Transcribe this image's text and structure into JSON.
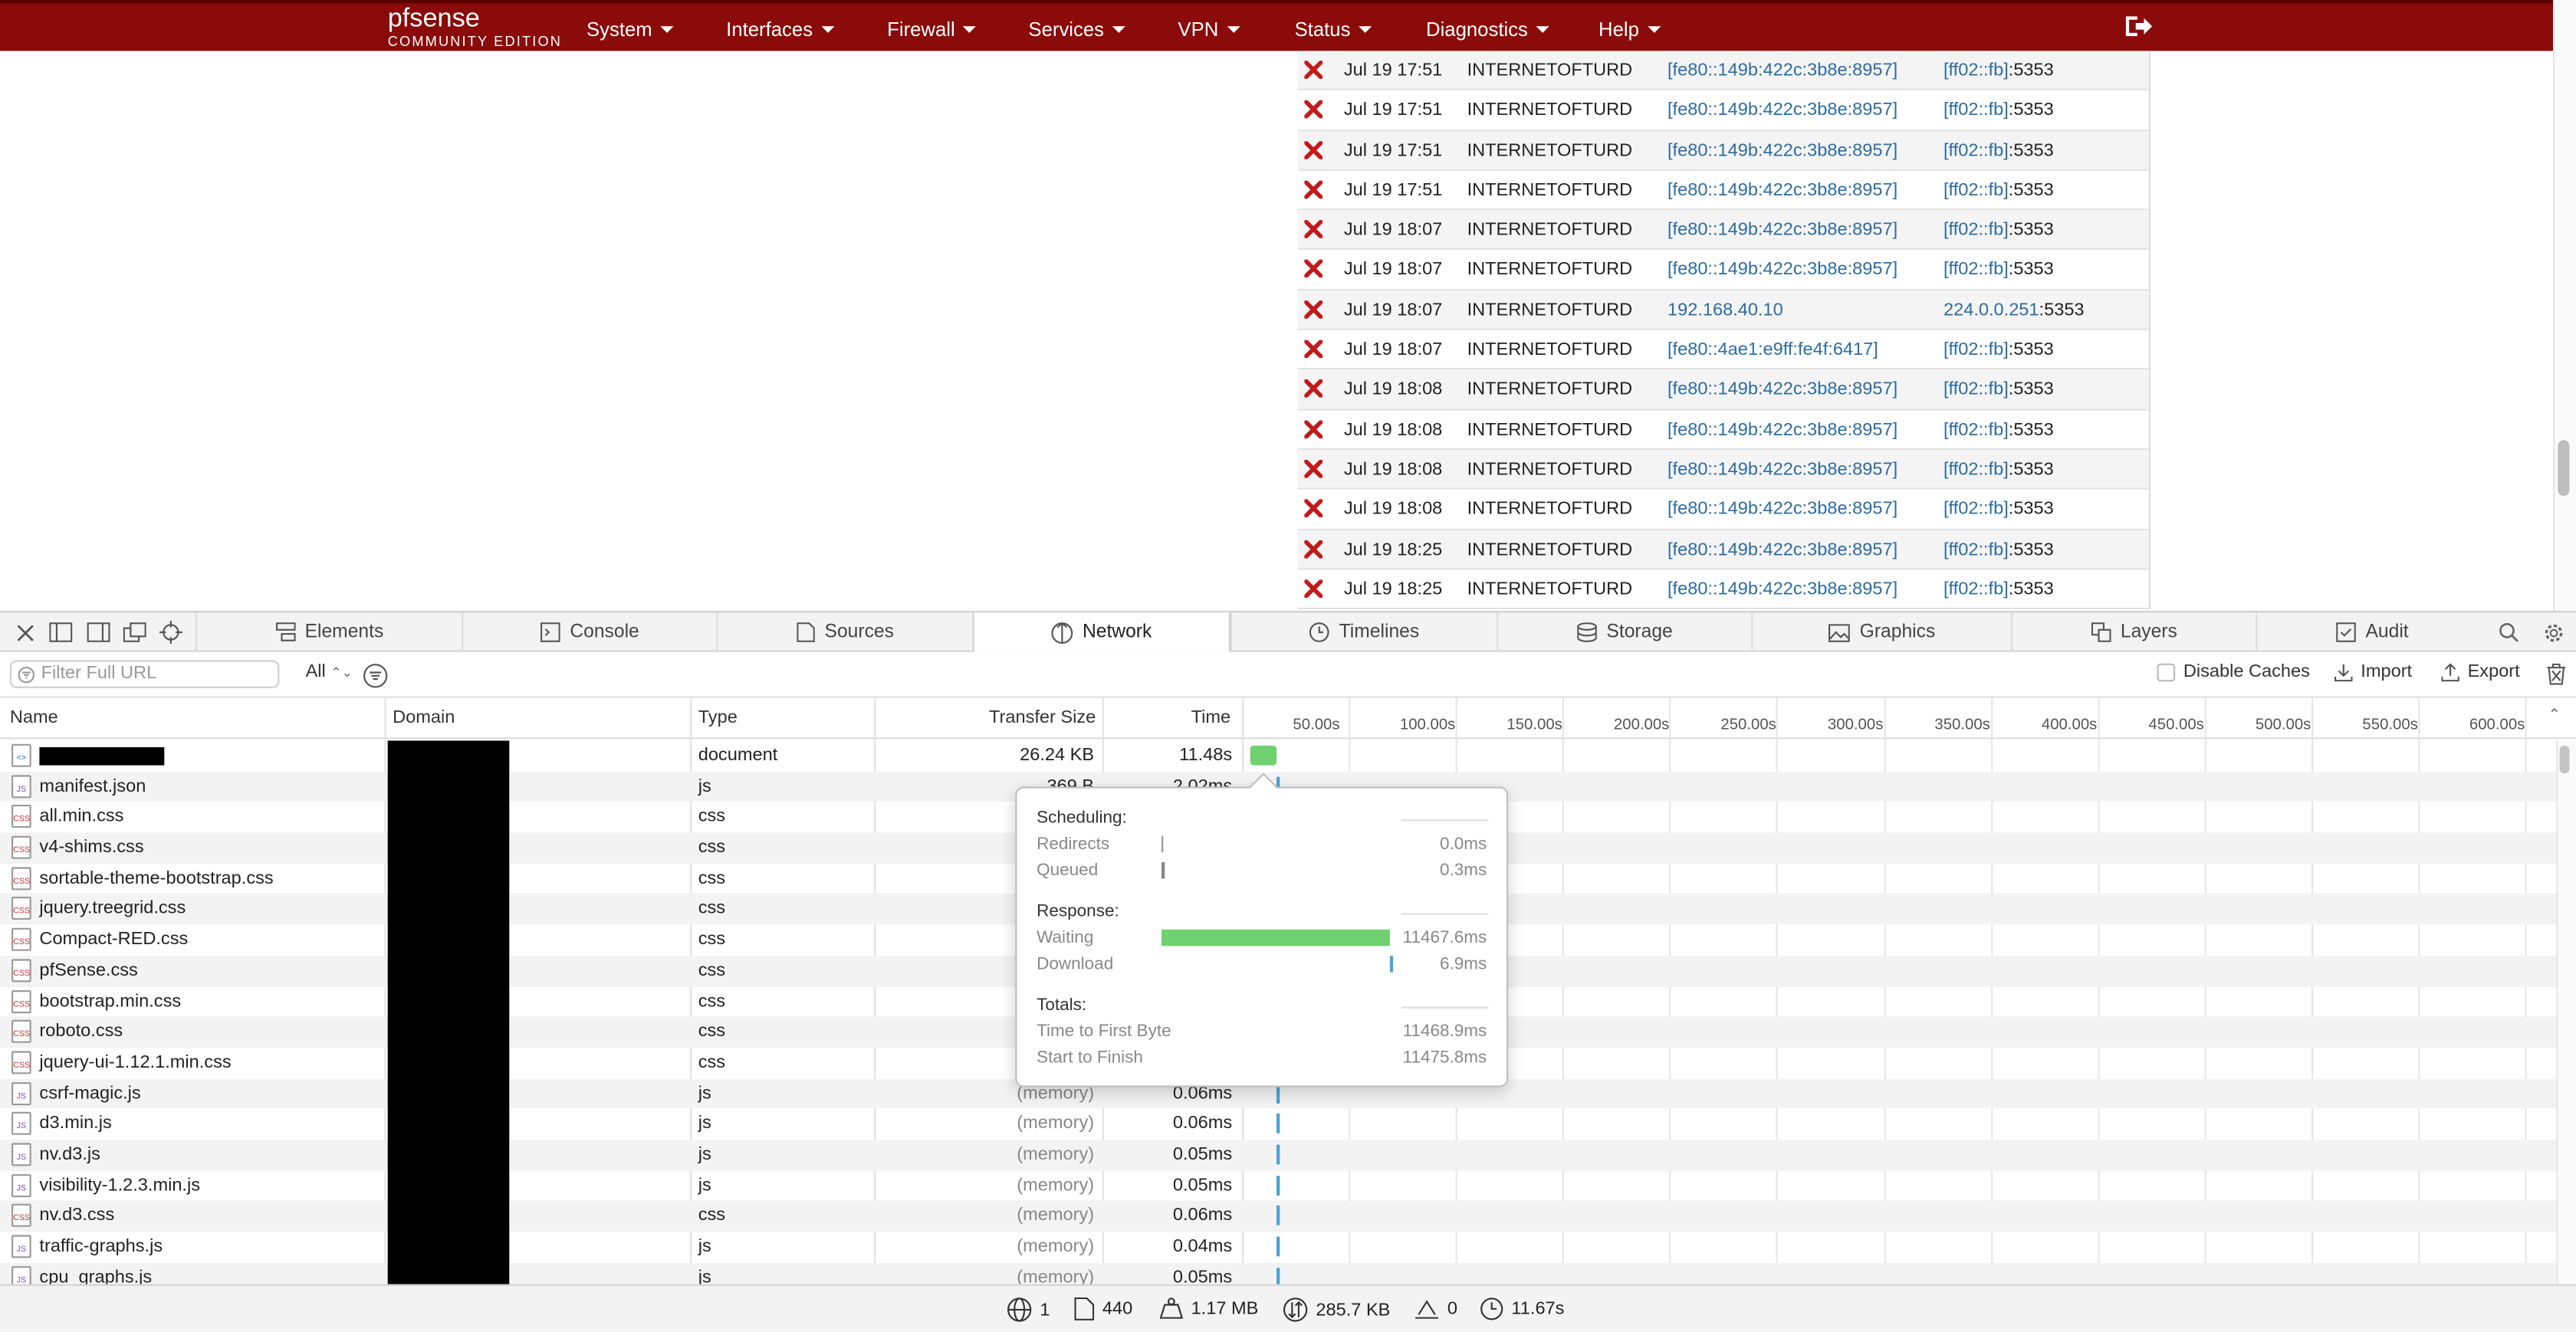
{
  "navbar": {
    "logo_main": "pf",
    "logo_main_rest": "sense",
    "logo_sub": "COMMUNITY EDITION",
    "items": [
      "System",
      "Interfaces",
      "Firewall",
      "Services",
      "VPN",
      "Status",
      "Diagnostics",
      "Help"
    ],
    "brand_color": "#8b0a0a"
  },
  "firewall_log": [
    {
      "time": "Jul 19 17:51",
      "iface": "INTERNETOFTURD",
      "src": "[fe80::149b:422c:3b8e:8957]",
      "dst_host": "[ff02::fb]",
      "dst_port": ":5353"
    },
    {
      "time": "Jul 19 17:51",
      "iface": "INTERNETOFTURD",
      "src": "[fe80::149b:422c:3b8e:8957]",
      "dst_host": "[ff02::fb]",
      "dst_port": ":5353"
    },
    {
      "time": "Jul 19 17:51",
      "iface": "INTERNETOFTURD",
      "src": "[fe80::149b:422c:3b8e:8957]",
      "dst_host": "[ff02::fb]",
      "dst_port": ":5353"
    },
    {
      "time": "Jul 19 17:51",
      "iface": "INTERNETOFTURD",
      "src": "[fe80::149b:422c:3b8e:8957]",
      "dst_host": "[ff02::fb]",
      "dst_port": ":5353"
    },
    {
      "time": "Jul 19 18:07",
      "iface": "INTERNETOFTURD",
      "src": "[fe80::149b:422c:3b8e:8957]",
      "dst_host": "[ff02::fb]",
      "dst_port": ":5353"
    },
    {
      "time": "Jul 19 18:07",
      "iface": "INTERNETOFTURD",
      "src": "[fe80::149b:422c:3b8e:8957]",
      "dst_host": "[ff02::fb]",
      "dst_port": ":5353"
    },
    {
      "time": "Jul 19 18:07",
      "iface": "INTERNETOFTURD",
      "src": "192.168.40.10",
      "dst_host": "224.0.0.251",
      "dst_port": ":5353"
    },
    {
      "time": "Jul 19 18:07",
      "iface": "INTERNETOFTURD",
      "src": "[fe80::4ae1:e9ff:fe4f:6417]",
      "dst_host": "[ff02::fb]",
      "dst_port": ":5353"
    },
    {
      "time": "Jul 19 18:08",
      "iface": "INTERNETOFTURD",
      "src": "[fe80::149b:422c:3b8e:8957]",
      "dst_host": "[ff02::fb]",
      "dst_port": ":5353"
    },
    {
      "time": "Jul 19 18:08",
      "iface": "INTERNETOFTURD",
      "src": "[fe80::149b:422c:3b8e:8957]",
      "dst_host": "[ff02::fb]",
      "dst_port": ":5353"
    },
    {
      "time": "Jul 19 18:08",
      "iface": "INTERNETOFTURD",
      "src": "[fe80::149b:422c:3b8e:8957]",
      "dst_host": "[ff02::fb]",
      "dst_port": ":5353"
    },
    {
      "time": "Jul 19 18:08",
      "iface": "INTERNETOFTURD",
      "src": "[fe80::149b:422c:3b8e:8957]",
      "dst_host": "[ff02::fb]",
      "dst_port": ":5353"
    },
    {
      "time": "Jul 19 18:25",
      "iface": "INTERNETOFTURD",
      "src": "[fe80::149b:422c:3b8e:8957]",
      "dst_host": "[ff02::fb]",
      "dst_port": ":5353"
    },
    {
      "time": "Jul 19 18:25",
      "iface": "INTERNETOFTURD",
      "src": "[fe80::149b:422c:3b8e:8957]",
      "dst_host": "[ff02::fb]",
      "dst_port": ":5353"
    }
  ],
  "devtools": {
    "tabs": [
      "Elements",
      "Console",
      "Sources",
      "Network",
      "Timelines",
      "Storage",
      "Graphics",
      "Layers",
      "Audit"
    ],
    "selected_tab": "Network",
    "filter_placeholder": "Filter Full URL",
    "type_filter": "All",
    "disable_caches_label": "Disable Caches",
    "import_label": "Import",
    "export_label": "Export",
    "columns": {
      "name": "Name",
      "domain": "Domain",
      "type": "Type",
      "transfer_size": "Transfer Size",
      "time": "Time"
    },
    "timeline_ticks": [
      "50.00s",
      "100.00s",
      "150.00s",
      "200.00s",
      "250.00s",
      "300.00s",
      "350.00s",
      "400.00s",
      "450.00s",
      "500.00s",
      "550.00s",
      "600.00s"
    ],
    "requests": [
      {
        "name": "",
        "redacted": true,
        "type": "document",
        "size": "26.24 KB",
        "time": "11.48s",
        "icon": "doc"
      },
      {
        "name": "manifest.json",
        "type": "js",
        "size": "369 B",
        "time": "2.02ms",
        "icon": "js"
      },
      {
        "name": "all.min.css",
        "type": "css",
        "size": "",
        "time": "",
        "icon": "css"
      },
      {
        "name": "v4-shims.css",
        "type": "css",
        "size": "",
        "time": "",
        "icon": "css"
      },
      {
        "name": "sortable-theme-bootstrap.css",
        "type": "css",
        "size": "",
        "time": "",
        "icon": "css"
      },
      {
        "name": "jquery.treegrid.css",
        "type": "css",
        "size": "",
        "time": "",
        "icon": "css"
      },
      {
        "name": "Compact-RED.css",
        "type": "css",
        "size": "",
        "time": "",
        "icon": "css"
      },
      {
        "name": "pfSense.css",
        "type": "css",
        "size": "",
        "time": "",
        "icon": "css"
      },
      {
        "name": "bootstrap.min.css",
        "type": "css",
        "size": "",
        "time": "",
        "icon": "css"
      },
      {
        "name": "roboto.css",
        "type": "css",
        "size": "",
        "time": "",
        "icon": "css"
      },
      {
        "name": "jquery-ui-1.12.1.min.css",
        "type": "css",
        "size": "",
        "time": "",
        "icon": "css"
      },
      {
        "name": "csrf-magic.js",
        "type": "js",
        "size": "(memory)",
        "time": "0.06ms",
        "icon": "js"
      },
      {
        "name": "d3.min.js",
        "type": "js",
        "size": "(memory)",
        "time": "0.06ms",
        "icon": "js"
      },
      {
        "name": "nv.d3.js",
        "type": "js",
        "size": "(memory)",
        "time": "0.05ms",
        "icon": "js"
      },
      {
        "name": "visibility-1.2.3.min.js",
        "type": "js",
        "size": "(memory)",
        "time": "0.05ms",
        "icon": "js"
      },
      {
        "name": "nv.d3.css",
        "type": "css",
        "size": "(memory)",
        "time": "0.06ms",
        "icon": "css"
      },
      {
        "name": "traffic-graphs.js",
        "type": "js",
        "size": "(memory)",
        "time": "0.04ms",
        "icon": "js"
      },
      {
        "name": "cpu_graphs.js",
        "type": "js",
        "size": "(memory)",
        "time": "0.05ms",
        "icon": "js"
      }
    ],
    "popover": {
      "scheduling_title": "Scheduling:",
      "redirects_label": "Redirects",
      "redirects_value": "0.0ms",
      "queued_label": "Queued",
      "queued_value": "0.3ms",
      "response_title": "Response:",
      "waiting_label": "Waiting",
      "waiting_value": "11467.6ms",
      "download_label": "Download",
      "download_value": "6.9ms",
      "totals_title": "Totals:",
      "ttfb_label": "Time to First Byte",
      "ttfb_value": "11468.9ms",
      "start_finish_label": "Start to Finish",
      "start_finish_value": "11475.8ms",
      "waiting_color": "#6fd16f",
      "download_color": "#4aa3d8"
    },
    "status": {
      "documents": "1",
      "resources": "440",
      "resource_size": "1.17 MB",
      "transferred": "285.7 KB",
      "redirects": "0",
      "load_time": "11.67s"
    }
  }
}
